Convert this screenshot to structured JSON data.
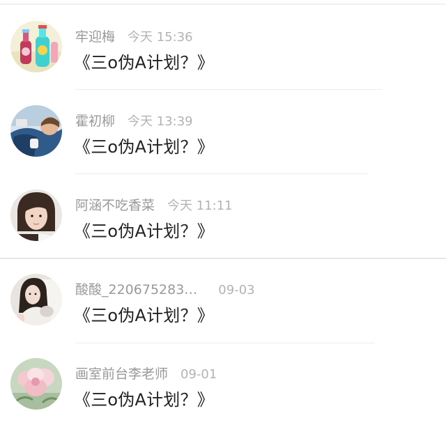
{
  "comments": [
    {
      "name": "牢迎梅",
      "time": "今天 15:36",
      "title": "《三o伪A计划？》",
      "avatar_icon": "avatar-bottles-icon"
    },
    {
      "name": "霍初柳",
      "time": "今天 13:39",
      "title": "《三o伪A计划？》",
      "avatar_icon": "avatar-person-blue-icon"
    },
    {
      "name": "阿涵不吃香菜",
      "time": "今天 11:11",
      "title": "《三o伪A计划？》",
      "avatar_icon": "avatar-person-portrait-icon"
    },
    {
      "name": "酸酸_220675283…",
      "time": "09-03",
      "title": "《三o伪A计划？》",
      "avatar_icon": "avatar-girl-icon"
    },
    {
      "name": "画室前台李老师",
      "time": "09-01",
      "title": "《三o伪A计划？》",
      "avatar_icon": "avatar-flower-icon"
    }
  ]
}
